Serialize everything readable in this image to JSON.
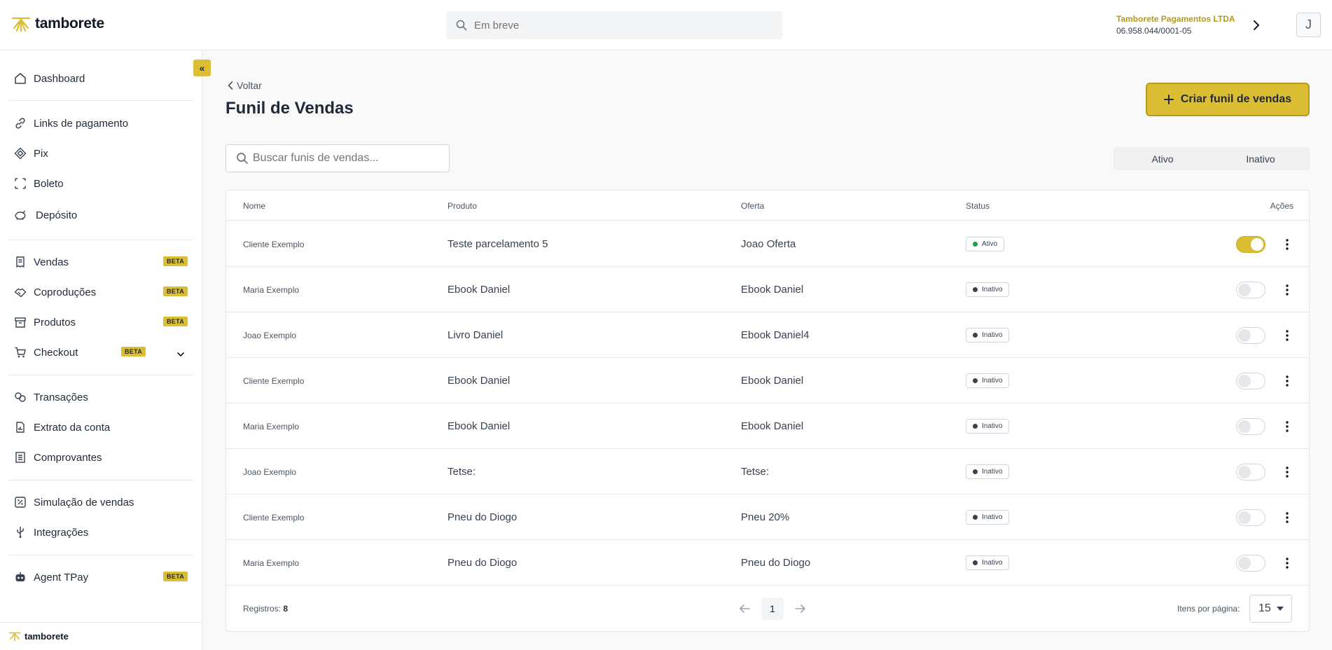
{
  "header": {
    "logo_text": "tamborete",
    "search_placeholder": "Em breve",
    "company_name": "Tamborete Pagamentos LTDA",
    "company_doc": "06.958.044/0001-05",
    "avatar_initial": "J"
  },
  "sidebar": {
    "collapse_label": "«",
    "items": [
      {
        "label": "Dashboard",
        "icon": "home-icon"
      },
      {
        "label": "Links de pagamento",
        "icon": "link-icon"
      },
      {
        "label": "Pix",
        "icon": "pix-icon"
      },
      {
        "label": "Boleto",
        "icon": "barcode-icon"
      },
      {
        "label": "Depósito",
        "icon": "piggy-bank-icon"
      },
      {
        "label": "Vendas",
        "icon": "receipt-icon",
        "badge": "BETA"
      },
      {
        "label": "Coproduções",
        "icon": "handshake-icon",
        "badge": "BETA"
      },
      {
        "label": "Produtos",
        "icon": "box-icon",
        "badge": "BETA"
      },
      {
        "label": "Checkout",
        "icon": "cart-icon",
        "badge": "BETA"
      },
      {
        "label": "Transações",
        "icon": "transactions-icon"
      },
      {
        "label": "Extrato da conta",
        "icon": "statement-icon"
      },
      {
        "label": "Comprovantes",
        "icon": "receipts-icon"
      },
      {
        "label": "Simulação de vendas",
        "icon": "percent-icon"
      },
      {
        "label": "Integrações",
        "icon": "usb-icon"
      },
      {
        "label": "Agent TPay",
        "icon": "robot-icon",
        "badge": "BETA"
      }
    ],
    "footer_logo_text": "tamborete"
  },
  "main": {
    "back_label": "Voltar",
    "title": "Funil de Vendas",
    "create_button": "Criar funil de vendas",
    "search_placeholder": "Buscar funis de vendas...",
    "filters": [
      "Ativo",
      "Inativo"
    ],
    "table": {
      "columns": [
        "Nome",
        "Produto",
        "Oferta",
        "Status",
        "Ações"
      ],
      "rows": [
        {
          "nome": "Cliente Exemplo",
          "produto": "Teste parcelamento 5",
          "oferta": "Joao Oferta",
          "status": "Ativo",
          "active": true
        },
        {
          "nome": "Maria Exemplo",
          "produto": "Ebook Daniel",
          "oferta": "Ebook Daniel",
          "status": "Inativo",
          "active": false
        },
        {
          "nome": "Joao Exemplo",
          "produto": "Livro Daniel",
          "oferta": "Ebook Daniel4",
          "status": "Inativo",
          "active": false
        },
        {
          "nome": "Cliente Exemplo",
          "produto": "Ebook Daniel",
          "oferta": "Ebook Daniel",
          "status": "Inativo",
          "active": false
        },
        {
          "nome": "Maria Exemplo",
          "produto": "Ebook Daniel",
          "oferta": "Ebook Daniel",
          "status": "Inativo",
          "active": false
        },
        {
          "nome": "Joao Exemplo",
          "produto": "Tetse:",
          "oferta": "Tetse:",
          "status": "Inativo",
          "active": false
        },
        {
          "nome": "Cliente Exemplo",
          "produto": "Pneu do Diogo",
          "oferta": "Pneu 20%",
          "status": "Inativo",
          "active": false
        },
        {
          "nome": "Maria Exemplo",
          "produto": "Pneu do Diogo",
          "oferta": "Pneu do Diogo",
          "status": "Inativo",
          "active": false
        }
      ]
    },
    "footer": {
      "registros_label": "Registros:",
      "registros_count": "8",
      "current_page": "1",
      "items_per_page_label": "Itens por página:",
      "items_per_page": "15"
    }
  },
  "colors": {
    "accent": "#dbbe34",
    "accent_dark": "#b59b1c",
    "active_dot": "#16a34a"
  }
}
